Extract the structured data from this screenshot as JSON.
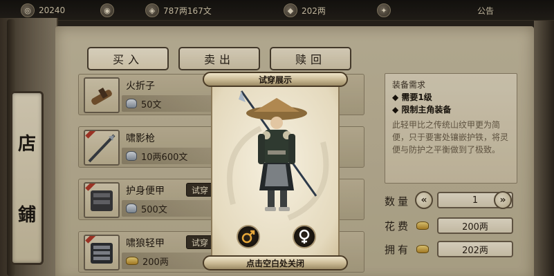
{
  "topbar": {
    "stat1": "20240",
    "stat2": "787两167文",
    "stat3": "202两",
    "stat4": "公告"
  },
  "shop_tab": {
    "char1": "店",
    "char2": "鋪"
  },
  "tabs": [
    {
      "label": "买入"
    },
    {
      "label": "卖出"
    },
    {
      "label": "赎回"
    }
  ],
  "items": [
    {
      "name": "火折子",
      "price": "50文",
      "currency": "silver",
      "tryon": "",
      "trail": "1"
    },
    {
      "name": "啸影枪",
      "price": "10两600文",
      "currency": "silver",
      "tryon": "",
      "trail": ""
    },
    {
      "name": "护身便甲",
      "price": "500文",
      "currency": "silver",
      "tryon": "试穿",
      "trail": ""
    },
    {
      "name": "啸狼轻甲",
      "price": "200两",
      "currency": "gold",
      "tryon": "试穿",
      "trail": ""
    }
  ],
  "info": {
    "title": "装备需求",
    "req1": "◆ 需要1级",
    "req2": "◆ 限制主角装备",
    "desc": "此轻甲比之传统山纹甲更为简便，只于要害处镶嵌护铁，将灵便与防护之平衡做到了极致。"
  },
  "quantity": {
    "label": "数量",
    "value": "1"
  },
  "cost": {
    "label": "花费",
    "value": "200两"
  },
  "owned": {
    "label": "拥有",
    "value": "202两"
  },
  "popup": {
    "title": "试穿展示",
    "close_hint": "点击空白处关闭",
    "male_icon": "male-symbol-icon",
    "female_icon": "female-symbol-icon"
  },
  "colors": {
    "accent": "#4a3b26",
    "paper": "#f6f0df"
  }
}
